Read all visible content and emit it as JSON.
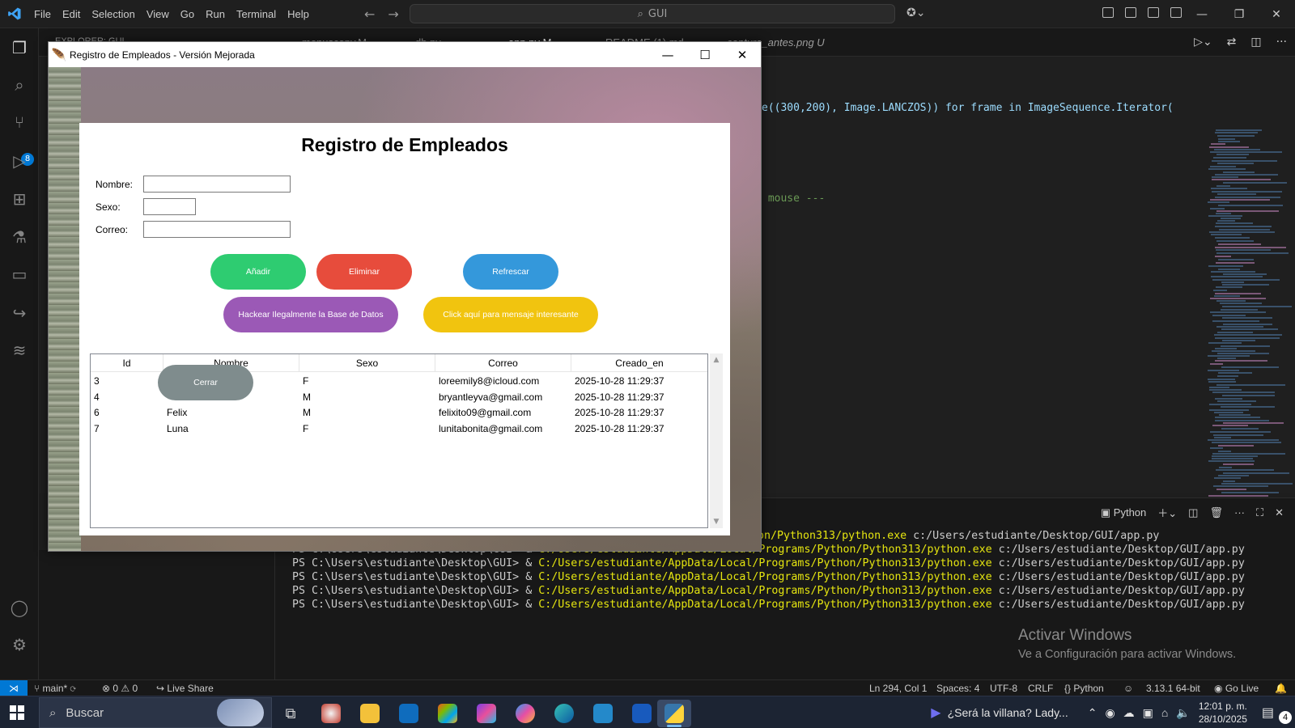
{
  "vscode": {
    "menu": [
      "File",
      "Edit",
      "Selection",
      "View",
      "Go",
      "Run",
      "Terminal",
      "Help"
    ],
    "search_text": "GUI",
    "explorer_label": "EXPLORER: GUI",
    "tabs": [
      "menuscopy.M",
      "db.py",
      "app.py M",
      "README (1).md",
      "captura_antes.png U"
    ],
    "code_line_1": "e((300,200), Image.LANCZOS)) for frame in ImageSequence.Iterator(",
    "code_line_2": " mouse ---",
    "source_control_badge": "8"
  },
  "terminal": {
    "profile_label": "Python",
    "prompt": "PS C:\\Users\\estudiante\\Desktop\\GUI> & ",
    "first_line_tail_exe": "on/Python313/python.exe",
    "exe": "C:/Users/estudiante/AppData/Local/Programs/Python/Python313/python.exe",
    "script": " c:/Users/estudiante/Desktop/GUI/app.py",
    "line_count": 5
  },
  "watermark": {
    "title": "Activar Windows",
    "subtitle": "Ve a Configuración para activar Windows."
  },
  "statusbar": {
    "branch": "main*",
    "problems": "⊗ 0 ⚠ 0",
    "live_share": "Live Share",
    "position": "Ln 294, Col 1",
    "spaces": "Spaces: 4",
    "encoding": "UTF-8",
    "eol": "CRLF",
    "language": "{} Python",
    "interpreter": "3.13.1 64-bit",
    "go_live": "Go Live"
  },
  "taskbar": {
    "search_placeholder": "Buscar",
    "media_title": "¿Será la villana? Lady...",
    "time": "12:01 p. m.",
    "date": "28/10/2025",
    "notification_count": "4"
  },
  "app": {
    "window_title": "Registro de Empleados - Versión Mejorada",
    "heading": "Registro de Empleados",
    "fields": {
      "nombre_label": "Nombre:",
      "sexo_label": "Sexo:",
      "correo_label": "Correo:",
      "nombre_value": "",
      "sexo_value": "",
      "correo_value": ""
    },
    "buttons": {
      "add": "Añadir",
      "delete": "Eliminar",
      "refresh": "Refrescar",
      "hack": "Hackear Ilegalmente la Base de Datos",
      "message": "Click aquí para mensaje interesante",
      "close": "Cerrar"
    },
    "colors": {
      "add": "#2ecc71",
      "delete": "#e74c3c",
      "refresh": "#3498db",
      "hack": "#9b59b6",
      "message": "#f1c40f",
      "close": "#7f8c8d"
    },
    "table": {
      "columns": [
        "Id",
        "Nombre",
        "Sexo",
        "Correo",
        "Creado_en"
      ],
      "rows": [
        [
          "3",
          "",
          "F",
          "loreemily8@icloud.com",
          "2025-10-28 11:29:37"
        ],
        [
          "4",
          "",
          "M",
          "bryantleyva@gmail.com",
          "2025-10-28 11:29:37"
        ],
        [
          "6",
          "Felix",
          "M",
          "felixito09@gmail.com",
          "2025-10-28 11:29:37"
        ],
        [
          "7",
          "Luna",
          "F",
          "lunitabonita@gmail.com",
          "2025-10-28 11:29:37"
        ]
      ]
    }
  }
}
